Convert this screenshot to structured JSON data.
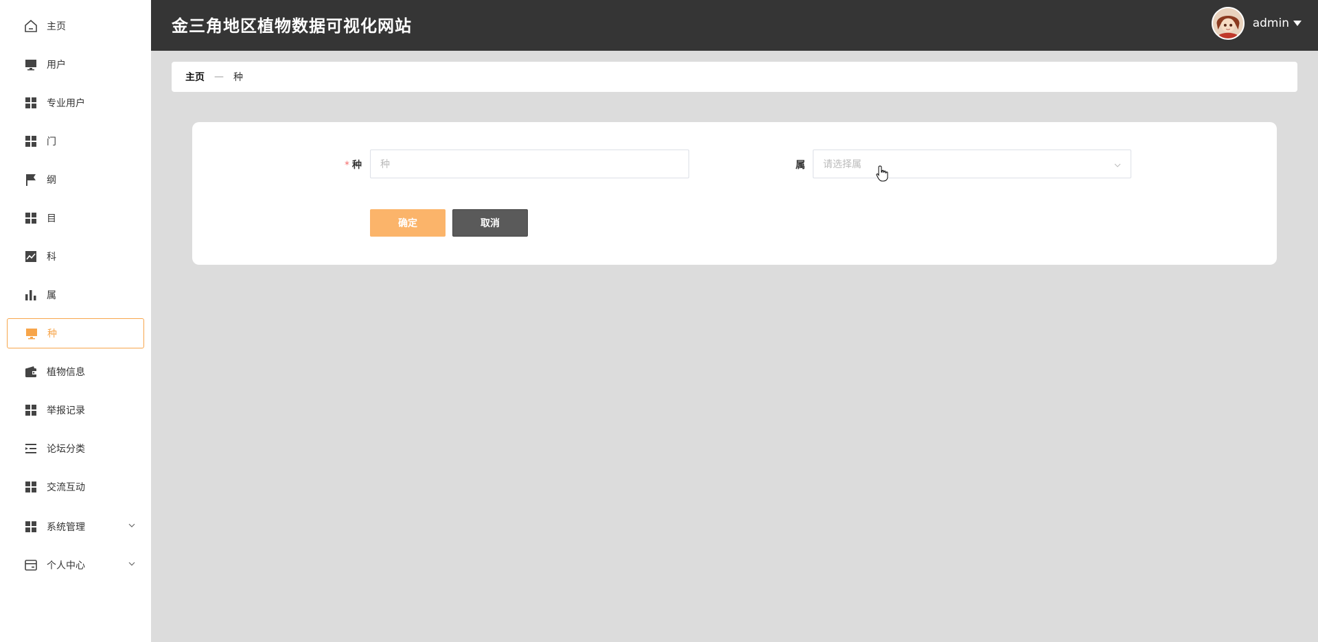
{
  "header": {
    "title": "金三角地区植物数据可视化网站",
    "user": "admin"
  },
  "sidebar": {
    "items": [
      {
        "label": "主页",
        "icon": "home-icon"
      },
      {
        "label": "用户",
        "icon": "monitor-icon"
      },
      {
        "label": "专业用户",
        "icon": "grid-icon"
      },
      {
        "label": "门",
        "icon": "grid-icon"
      },
      {
        "label": "纲",
        "icon": "flag-icon"
      },
      {
        "label": "目",
        "icon": "grid-icon"
      },
      {
        "label": "科",
        "icon": "chart-line-icon"
      },
      {
        "label": "属",
        "icon": "bar-chart-icon"
      },
      {
        "label": "种",
        "icon": "monitor-icon",
        "active": true
      },
      {
        "label": "植物信息",
        "icon": "wallet-icon"
      },
      {
        "label": "举报记录",
        "icon": "grid-icon"
      },
      {
        "label": "论坛分类",
        "icon": "list-indent-icon"
      },
      {
        "label": "交流互动",
        "icon": "grid-icon"
      },
      {
        "label": "系统管理",
        "icon": "grid-icon",
        "expandable": true
      },
      {
        "label": "个人中心",
        "icon": "card-icon",
        "expandable": true
      }
    ]
  },
  "breadcrumb": {
    "home": "主页",
    "separator": "—",
    "current": "种"
  },
  "form": {
    "species_label": "种",
    "species_required_mark": "*",
    "species_placeholder": "种",
    "genus_label": "属",
    "genus_placeholder": "请选择属",
    "ok_label": "确定",
    "cancel_label": "取消"
  },
  "colors": {
    "accent": "#f7a54a",
    "topbar": "#353535",
    "background": "#dcdcdc",
    "ok_button": "#fbb46a",
    "cancel_button": "#5a5a5a"
  }
}
